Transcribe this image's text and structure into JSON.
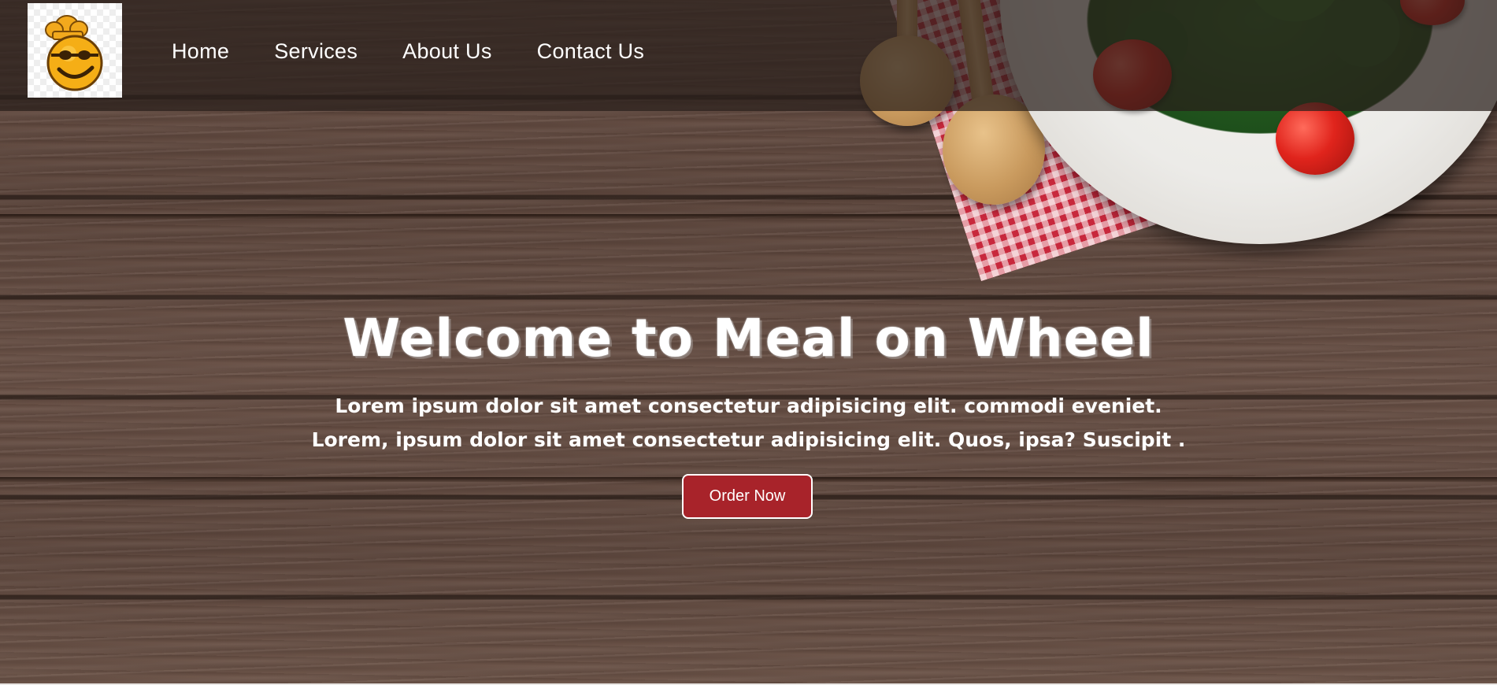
{
  "header": {
    "logo_icon": "chef-smiley-logo-icon",
    "nav": [
      {
        "label": "Home"
      },
      {
        "label": "Services"
      },
      {
        "label": "About Us"
      },
      {
        "label": "Contact Us"
      }
    ]
  },
  "hero": {
    "title": "Welcome to Meal on Wheel",
    "line1": "Lorem ipsum dolor sit amet consectetur adipisicing elit. commodi eveniet.",
    "line2": "Lorem, ipsum dolor sit amet consectetur adipisicing elit. Quos, ipsa? Suscipit .",
    "button_label": "Order Now"
  },
  "colors": {
    "button_bg": "#a8232a",
    "header_overlay": "rgba(40,30,26,0.72)",
    "text": "#ffffff"
  }
}
